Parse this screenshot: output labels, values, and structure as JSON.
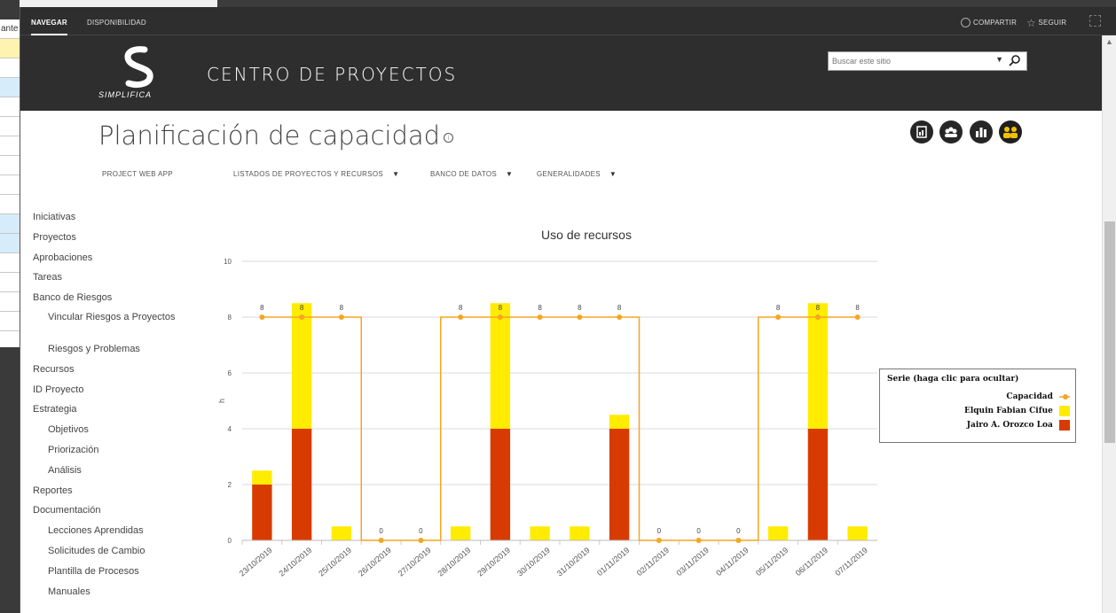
{
  "suitebar": {
    "navegar": "NAVEGAR",
    "disponibilidad": "DISPONIBILIDAD",
    "compartir": "COMPARTIR",
    "seguir": "SEGUIR"
  },
  "brand": {
    "logo_text": "SIMPLIFICA",
    "site_title": "CENTRO DE PROYECTOS",
    "search_placeholder": "Buscar este sitio"
  },
  "page": {
    "title": "Planificación de capacidad"
  },
  "topnav": [
    "PROJECT WEB APP",
    "LISTADOS DE PROYECTOS Y RECURSOS",
    "BANCO DE DATOS",
    "GENERALIDADES"
  ],
  "background_app": {
    "cell_text": "ante"
  },
  "leftnav": [
    {
      "label": "Iniciativas",
      "level": 0
    },
    {
      "label": "Proyectos",
      "level": 0
    },
    {
      "label": "Aprobaciones",
      "level": 0
    },
    {
      "label": "Tareas",
      "level": 0
    },
    {
      "label": "Banco de Riesgos",
      "level": 0
    },
    {
      "label": "Vincular Riesgos a Proyectos",
      "level": 1
    },
    {
      "label": "Riesgos y Problemas",
      "level": 1
    },
    {
      "label": "Recursos",
      "level": 0
    },
    {
      "label": "ID Proyecto",
      "level": 0
    },
    {
      "label": "Estrategia",
      "level": 0
    },
    {
      "label": "Objetivos",
      "level": 1
    },
    {
      "label": "Priorización",
      "level": 1
    },
    {
      "label": "Análisis",
      "level": 1
    },
    {
      "label": "Reportes",
      "level": 0
    },
    {
      "label": "Documentación",
      "level": 0
    },
    {
      "label": "Lecciones Aprendidas",
      "level": 1
    },
    {
      "label": "Solicitudes de Cambio",
      "level": 1
    },
    {
      "label": "Plantilla de Procesos",
      "level": 1
    },
    {
      "label": "Manuales",
      "level": 1
    }
  ],
  "colors": {
    "capacity": "#f5a623",
    "series_yellow": "#ffec00",
    "series_red": "#d83b01"
  },
  "chart_data": {
    "type": "bar",
    "stacked": true,
    "title": "Uso de recursos",
    "ylabel": "h",
    "ylim": [
      0,
      10
    ],
    "yticks": [
      0,
      2,
      4,
      6,
      8,
      10
    ],
    "grid": true,
    "legend_title": "Serie (haga clic para ocultar)",
    "legend_position": "right",
    "categories": [
      "23/10/2019",
      "24/10/2019",
      "25/10/2019",
      "26/10/2019",
      "27/10/2019",
      "28/10/2019",
      "29/10/2019",
      "30/10/2019",
      "31/10/2019",
      "01/11/2019",
      "02/11/2019",
      "03/11/2019",
      "04/11/2019",
      "05/11/2019",
      "06/11/2019",
      "07/11/2019"
    ],
    "series": [
      {
        "name": "Jairo A. Orozco Loa",
        "type": "bar",
        "values": [
          2,
          4,
          0,
          0,
          0,
          0,
          4,
          0,
          0,
          4,
          0,
          0,
          0,
          0,
          4,
          0
        ]
      },
      {
        "name": "Elquin Fabian Cifue",
        "type": "bar",
        "values": [
          0.5,
          4.5,
          0.5,
          0,
          0,
          0.5,
          4.5,
          0.5,
          0.5,
          0.5,
          0,
          0,
          0,
          0.5,
          4.5,
          0.5
        ]
      },
      {
        "name": "Capacidad",
        "type": "step-line",
        "values": [
          8,
          8,
          8,
          0,
          0,
          8,
          8,
          8,
          8,
          8,
          0,
          0,
          0,
          8,
          8,
          8
        ]
      }
    ]
  }
}
